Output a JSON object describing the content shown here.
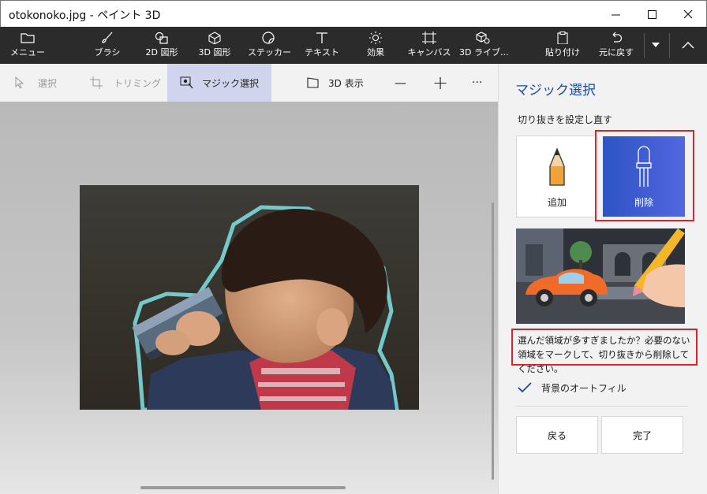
{
  "window": {
    "title": "otokonoko.jpg - ペイント 3D"
  },
  "ribbon": {
    "menu": "メニュー",
    "items": [
      "ブラシ",
      "2D 図形",
      "3D 図形",
      "ステッカー",
      "テキスト",
      "効果",
      "キャンバス",
      "3D ライブ..."
    ],
    "paste": "貼り付け",
    "undo": "元に戻す"
  },
  "toolbar": {
    "select": "選択",
    "crop": "トリミング",
    "magic_select": "マジック選択",
    "view3d": "3D 表示",
    "zoom_out": "—",
    "zoom_in": "+",
    "more": "···"
  },
  "panel": {
    "title": "マジック選択",
    "subtitle": "切り抜きを設定し直す",
    "add_label": "追加",
    "remove_label": "削除",
    "hint": "選んだ領域が多すぎましたか？必要のない領域をマークして、切り抜きから削除してください。",
    "autofill_label": "背景のオートフィル",
    "autofill_checked": true,
    "back_button": "戻る",
    "done_button": "完了"
  },
  "colors": {
    "accent": "#1a4ba8",
    "highlight_border": "#d9242b",
    "active_tool_bg": "#d0d4ec",
    "remove_card_gradient_start": "#2d54c4",
    "remove_card_gradient_end": "#5366e0"
  }
}
